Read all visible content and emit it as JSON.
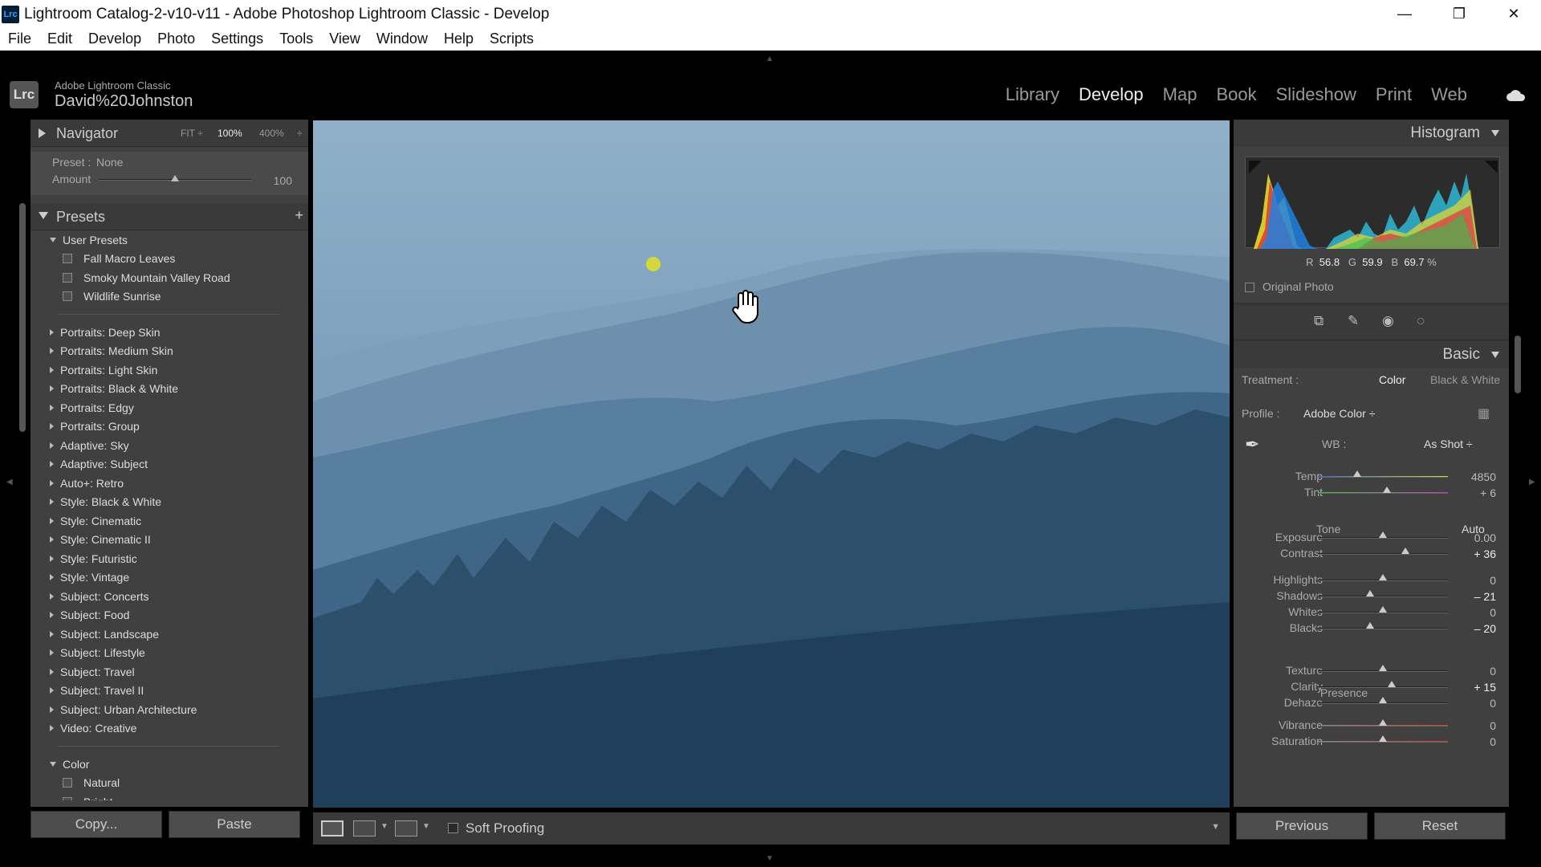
{
  "window": {
    "app_icon": "Lrc",
    "title": "Lightroom Catalog-2-v10-v11 - Adobe Photoshop Lightroom Classic - Develop",
    "minimize": "—",
    "maximize": "❐",
    "close": "✕"
  },
  "menu": [
    "File",
    "Edit",
    "Develop",
    "Photo",
    "Settings",
    "Tools",
    "View",
    "Window",
    "Help",
    "Scripts"
  ],
  "identity": {
    "badge": "Lrc",
    "brand": "Adobe Lightroom Classic",
    "user": "David%20Johnston",
    "modules": [
      "Library",
      "Develop",
      "Map",
      "Book",
      "Slideshow",
      "Print",
      "Web"
    ],
    "active_module": "Develop"
  },
  "navigator": {
    "title": "Navigator",
    "zoom_fit": "FIT ÷",
    "zoom_100": "100%",
    "zoom_400": "400%",
    "zoom_more": "÷"
  },
  "preset_amount": {
    "preset_label": "Preset :",
    "preset_value": "None",
    "amount_label": "Amount",
    "amount_value": "100",
    "amount_fraction": 0.5
  },
  "presets": {
    "title": "Presets",
    "add": "+",
    "user_group": "User Presets",
    "user_presets": [
      "Fall Macro Leaves",
      "Smoky Mountain Valley Road",
      "Wildlife Sunrise"
    ],
    "groups": [
      "Portraits: Deep Skin",
      "Portraits: Medium Skin",
      "Portraits: Light Skin",
      "Portraits: Black & White",
      "Portraits: Edgy",
      "Portraits: Group",
      "Adaptive: Sky",
      "Adaptive: Subject",
      "Auto+: Retro",
      "Style: Black & White",
      "Style: Cinematic",
      "Style: Cinematic II",
      "Style: Futuristic",
      "Style: Vintage",
      "Subject: Concerts",
      "Subject: Food",
      "Subject: Landscape",
      "Subject: Lifestyle",
      "Subject: Travel",
      "Subject: Travel II",
      "Subject: Urban Architecture",
      "Video: Creative"
    ],
    "color_group": "Color",
    "color_presets": [
      "Natural",
      "Bright"
    ]
  },
  "left_buttons": {
    "copy": "Copy...",
    "paste": "Paste"
  },
  "toolbar": {
    "soft_proofing": "Soft Proofing"
  },
  "right_buttons": {
    "previous": "Previous",
    "reset": "Reset"
  },
  "histogram": {
    "title": "Histogram",
    "r_label": "R",
    "r_value": "56.8",
    "g_label": "G",
    "g_value": "59.9",
    "b_label": "B",
    "b_value": "69.7",
    "unit": "%",
    "original_photo": "Original Photo"
  },
  "basic": {
    "title": "Basic",
    "treatment_label": "Treatment :",
    "treatment_color": "Color",
    "treatment_bw": "Black & White",
    "profile_label": "Profile :",
    "profile_value": "Adobe Color ÷",
    "wb_label": "WB :",
    "wb_value": "As Shot ÷",
    "tone_label": "Tone",
    "auto_label": "Auto",
    "presence_label": "Presence",
    "sliders": [
      {
        "label": "Temp",
        "value": "4850",
        "pos": 0.3,
        "changed": false
      },
      {
        "label": "Tint",
        "value": "+ 6",
        "pos": 0.53,
        "changed": false
      },
      {
        "label": "Exposure",
        "value": "0.00",
        "pos": 0.5,
        "changed": false
      },
      {
        "label": "Contrast",
        "value": "+ 36",
        "pos": 0.67,
        "changed": true
      },
      {
        "label": "Highlights",
        "value": "0",
        "pos": 0.5,
        "changed": false
      },
      {
        "label": "Shadows",
        "value": "– 21",
        "pos": 0.4,
        "changed": true
      },
      {
        "label": "Whites",
        "value": "0",
        "pos": 0.5,
        "changed": false
      },
      {
        "label": "Blacks",
        "value": "– 20",
        "pos": 0.4,
        "changed": true
      },
      {
        "label": "Texture",
        "value": "0",
        "pos": 0.5,
        "changed": false
      },
      {
        "label": "Clarity",
        "value": "+ 15",
        "pos": 0.57,
        "changed": true
      },
      {
        "label": "Dehaze",
        "value": "0",
        "pos": 0.5,
        "changed": false
      },
      {
        "label": "Vibrance",
        "value": "0",
        "pos": 0.5,
        "changed": false
      },
      {
        "label": "Saturation",
        "value": "0",
        "pos": 0.5,
        "changed": false
      }
    ]
  }
}
